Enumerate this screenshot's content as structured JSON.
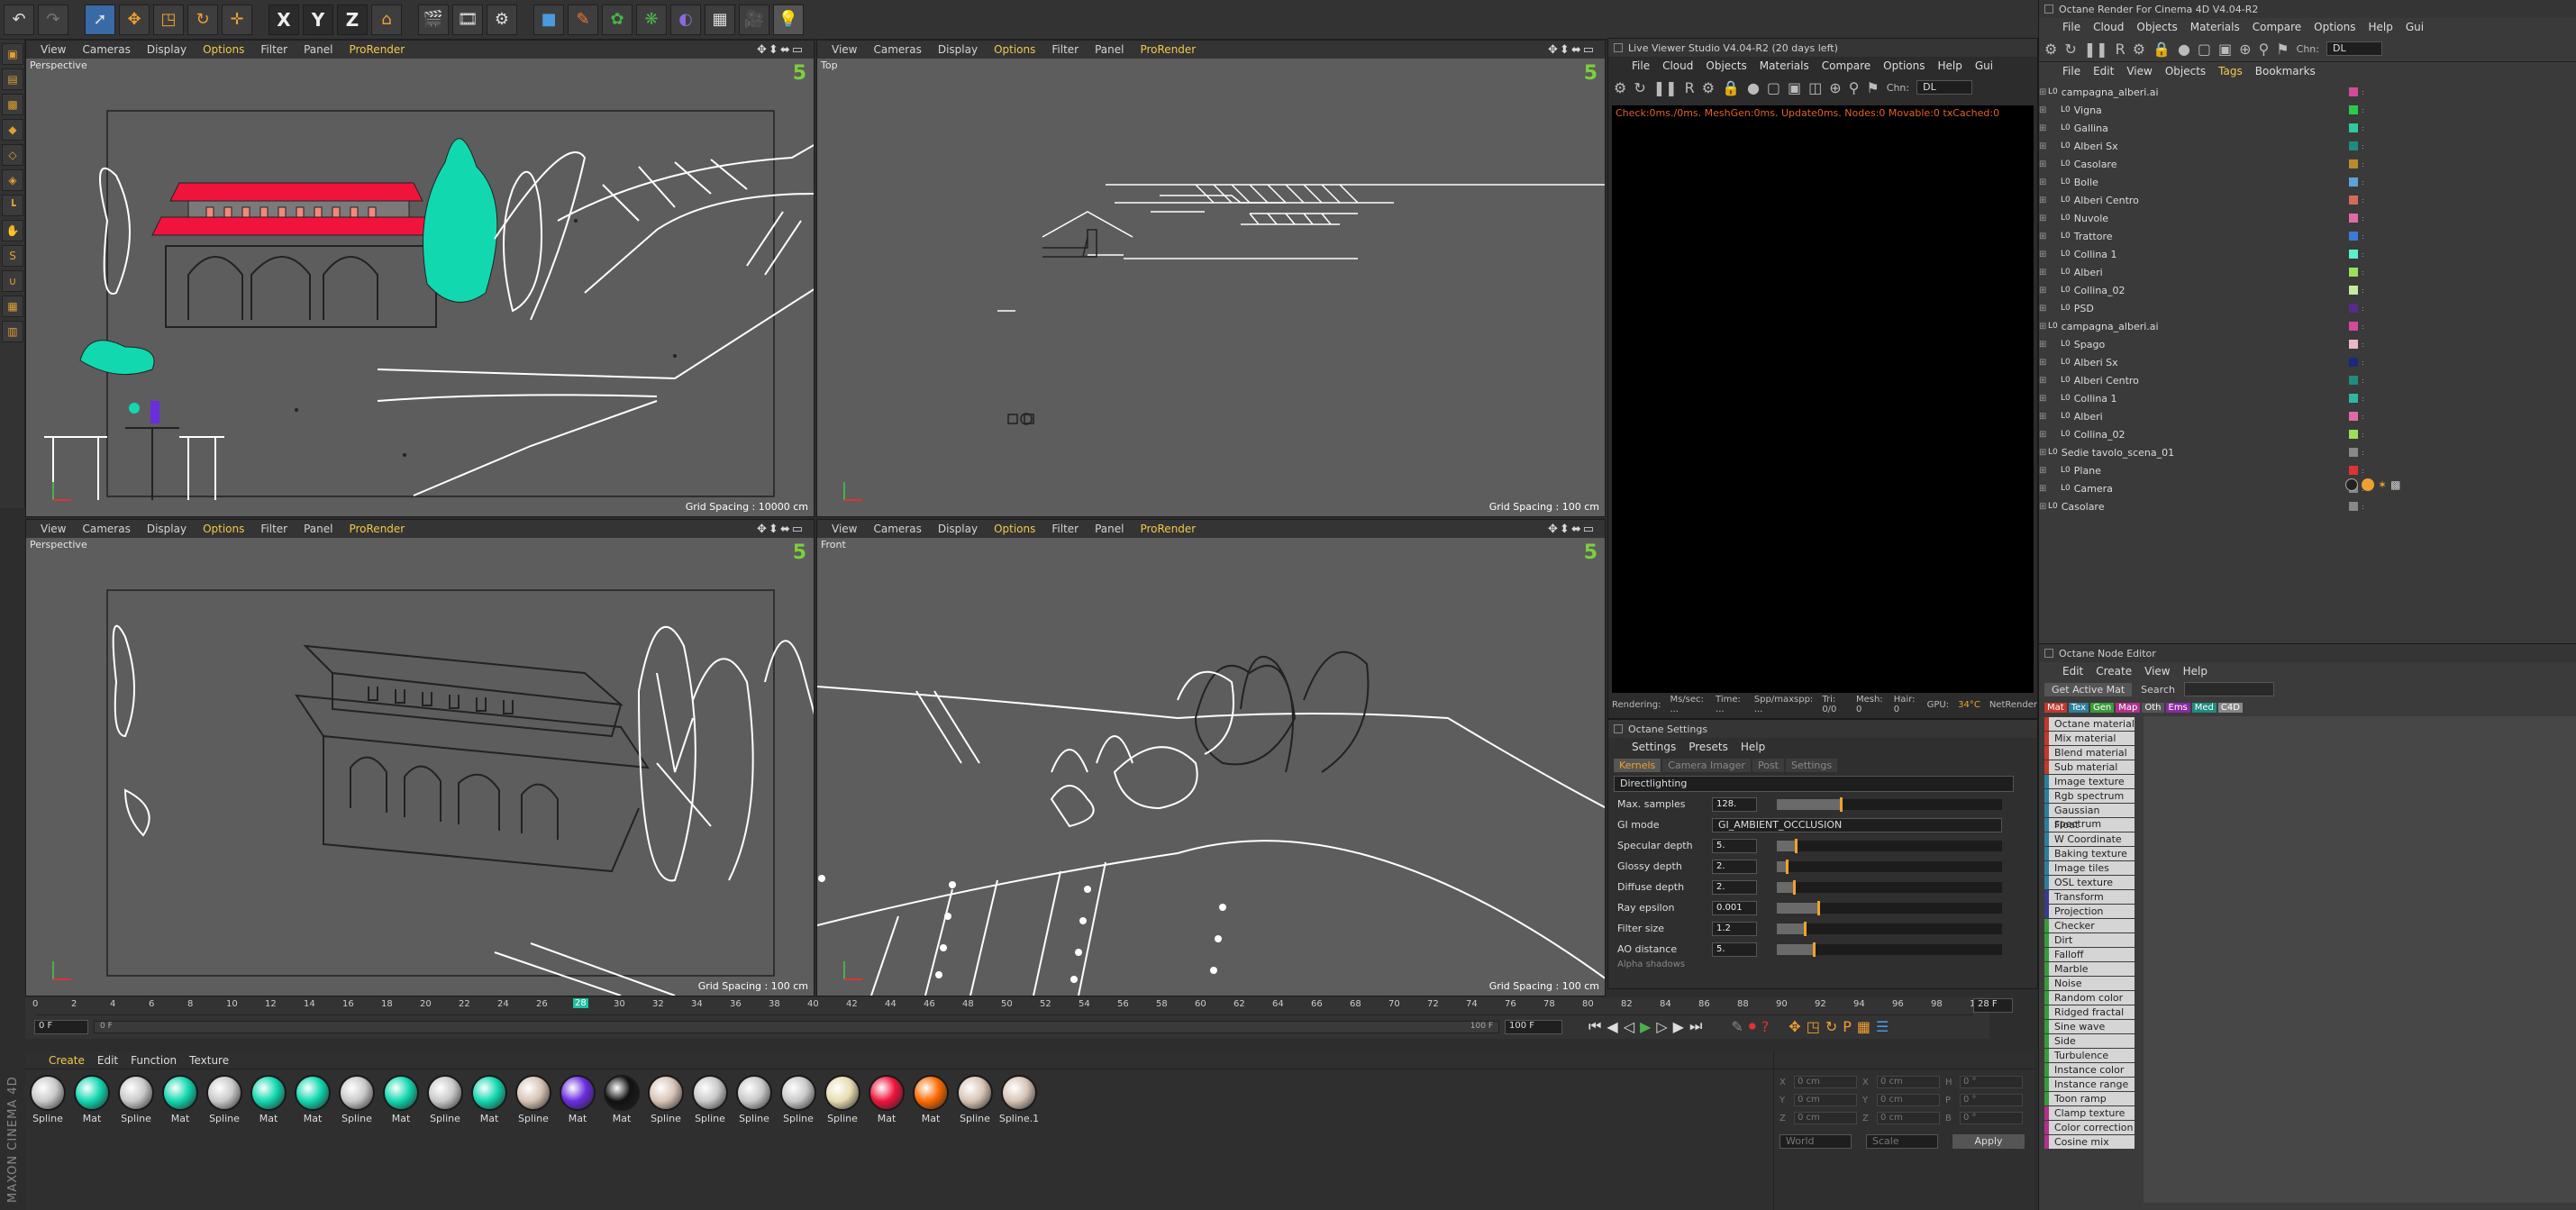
{
  "main_toolbar": {
    "axis_x": "X",
    "axis_y": "Y",
    "axis_z": "Z"
  },
  "viewports": {
    "menu": [
      "View",
      "Cameras",
      "Display",
      "Options",
      "Filter",
      "Panel",
      "ProRender"
    ],
    "vp1": {
      "name": "Perspective",
      "grid_spacing": "Grid Spacing : 10000 cm"
    },
    "vp2": {
      "name": "Top",
      "grid_spacing": "Grid Spacing : 100 cm"
    },
    "vp3": {
      "name": "Perspective",
      "grid_spacing": "Grid Spacing : 100 cm"
    },
    "vp4": {
      "name": "Front",
      "grid_spacing": "Grid Spacing : 100 cm"
    },
    "number_badge": "5"
  },
  "live_viewer": {
    "title": "Live Viewer Studio V4.04-R2 (20 days left)",
    "menu": [
      "File",
      "Cloud",
      "Objects",
      "Materials",
      "Compare",
      "Options",
      "Help",
      "Gui"
    ],
    "channel_label": "Chn:",
    "channel_value": "DL",
    "status_line": "Check:0ms./0ms. MeshGen:0ms. Update0ms. Nodes:0 Movable:0 txCached:0",
    "footer_items": [
      "Rendering:",
      "Ms/sec: ...",
      "Time: ...",
      "Spp/maxspp: ...",
      "Tri: 0/0",
      "Mesh: 0",
      "Hair: 0",
      "GPU:",
      "34°C",
      "NetRender"
    ]
  },
  "octane_settings": {
    "title": "Octane Settings",
    "menu": [
      "Settings",
      "Presets",
      "Help"
    ],
    "tabs": [
      "Kernels",
      "Camera Imager",
      "Post",
      "Settings"
    ],
    "kernel_dropdown": "Directlighting",
    "rows": [
      {
        "label": "Max. samples",
        "value": "128.",
        "fill": 0.28
      },
      {
        "label": "GI mode",
        "value": "GI_AMBIENT_OCCLUSION"
      },
      {
        "label": "Specular depth",
        "value": "5.",
        "fill": 0.08
      },
      {
        "label": "Glossy depth",
        "value": "2.",
        "fill": 0.04
      },
      {
        "label": "Diffuse depth",
        "value": "2.",
        "fill": 0.07
      },
      {
        "label": "Ray epsilon",
        "value": "0.001",
        "fill": 0.18
      },
      {
        "label": "Filter size",
        "value": "1.2",
        "fill": 0.12
      },
      {
        "label": "AO distance",
        "value": "5.",
        "fill": 0.16
      }
    ],
    "footer": "Alpha shadows"
  },
  "timeline": {
    "ticks": [
      "0",
      "2",
      "4",
      "6",
      "8",
      "10",
      "12",
      "14",
      "16",
      "18",
      "20",
      "22",
      "24",
      "26",
      "28",
      "30",
      "32",
      "34",
      "36",
      "38",
      "40",
      "42",
      "44",
      "46",
      "48",
      "50",
      "52",
      "54",
      "56",
      "58",
      "60",
      "62",
      "64",
      "66",
      "68",
      "70",
      "72",
      "74",
      "76",
      "78",
      "80",
      "82",
      "84",
      "86",
      "88",
      "90",
      "92",
      "94",
      "96",
      "98",
      "100"
    ],
    "current_frame": "28",
    "end_field": "28 F",
    "start_field": "0 F",
    "range_start": "0 F",
    "range_end": "100 F",
    "range_end2": "100 F"
  },
  "material_manager": {
    "menu": [
      "Create",
      "Edit",
      "Function",
      "Texture"
    ],
    "items": [
      {
        "label": "Spline",
        "color": "#c9c9c9"
      },
      {
        "label": "Mat",
        "color": "#12d8b0"
      },
      {
        "label": "Spline",
        "color": "#c9c9c9"
      },
      {
        "label": "Mat",
        "color": "#12d8b0"
      },
      {
        "label": "Spline",
        "color": "#c9c9c9"
      },
      {
        "label": "Mat",
        "color": "#12d8b0"
      },
      {
        "label": "Mat",
        "color": "#12d8b0"
      },
      {
        "label": "Spline",
        "color": "#c9c9c9"
      },
      {
        "label": "Mat",
        "color": "#12d8b0"
      },
      {
        "label": "Spline",
        "color": "#c9c9c9"
      },
      {
        "label": "Mat",
        "color": "#12d8b0"
      },
      {
        "label": "Spline",
        "color": "#d8c4b5"
      },
      {
        "label": "Mat",
        "color": "#6a2ce0"
      },
      {
        "label": "Mat",
        "color": "#111111"
      },
      {
        "label": "Spline",
        "color": "#d8c4b5"
      },
      {
        "label": "Spline",
        "color": "#c9c9c9"
      },
      {
        "label": "Spline",
        "color": "#c9c9c9"
      },
      {
        "label": "Spline",
        "color": "#c9c9c9"
      },
      {
        "label": "Spline",
        "color": "#e8dcb0"
      },
      {
        "label": "Mat",
        "color": "#f0143c"
      },
      {
        "label": "Mat",
        "color": "#ff6a00"
      },
      {
        "label": "Spline",
        "color": "#d8c4b5"
      },
      {
        "label": "Spline.1",
        "color": "#d8c4b5"
      }
    ]
  },
  "coordinates": {
    "rows": [
      {
        "a": "X",
        "av": "0 cm",
        "b": "X",
        "bv": "0 cm",
        "c": "H",
        "cv": "0 °"
      },
      {
        "a": "Y",
        "av": "0 cm",
        "b": "Y",
        "bv": "0 cm",
        "c": "P",
        "cv": "0 °"
      },
      {
        "a": "Z",
        "av": "0 cm",
        "b": "Z",
        "bv": "0 cm",
        "c": "B",
        "cv": "0 °"
      }
    ],
    "world": "World",
    "scale": "Scale",
    "apply": "Apply"
  },
  "right_panel": {
    "title": "Octane Render For Cinema 4D V4.04-R2",
    "menu": [
      "File",
      "Cloud",
      "Objects",
      "Materials",
      "Compare",
      "Options",
      "Help",
      "Gui"
    ],
    "channel_label": "Chn:",
    "channel_value": "DL",
    "obj_menu": [
      "File",
      "Edit",
      "View",
      "Objects",
      "Tags",
      "Bookmarks"
    ],
    "objects": [
      {
        "name": "campagna_alberi.ai",
        "indent": 0,
        "color": "#d34a9a"
      },
      {
        "name": "Vigna",
        "indent": 1,
        "color": "#2fc94a"
      },
      {
        "name": "Gallina",
        "indent": 1,
        "color": "#2fc9a0"
      },
      {
        "name": "Alberi Sx",
        "indent": 1,
        "color": "#1e8c80"
      },
      {
        "name": "Casolare",
        "indent": 1,
        "color": "#b98a2b"
      },
      {
        "name": "Bolle",
        "indent": 1,
        "color": "#5fa0d8"
      },
      {
        "name": "Alberi Centro",
        "indent": 1,
        "color": "#d56a5a"
      },
      {
        "name": "Nuvole",
        "indent": 1,
        "color": "#e06aa8"
      },
      {
        "name": "Trattore",
        "indent": 1,
        "color": "#3a7ad8"
      },
      {
        "name": "Collina 1",
        "indent": 1,
        "color": "#5cf0c8"
      },
      {
        "name": "Alberi",
        "indent": 1,
        "color": "#9ae05a"
      },
      {
        "name": "Collina_02",
        "indent": 1,
        "color": "#c6e8a0"
      },
      {
        "name": "PSD",
        "indent": 1,
        "color": "#5a2a8a"
      },
      {
        "name": "campagna_alberi.ai",
        "indent": 0,
        "color": "#d34a9a"
      },
      {
        "name": "Spago",
        "indent": 1,
        "color": "#e8b8c8"
      },
      {
        "name": "Alberi Sx",
        "indent": 1,
        "color": "#1a2a7a"
      },
      {
        "name": "Alberi Centro",
        "indent": 1,
        "color": "#1e8c80"
      },
      {
        "name": "Collina 1",
        "indent": 1,
        "color": "#2fb8a0"
      },
      {
        "name": "Alberi",
        "indent": 1,
        "color": "#e06aa8"
      },
      {
        "name": "Collina_02",
        "indent": 1,
        "color": "#9ae05a"
      },
      {
        "name": "Sedie tavolo_scena_01",
        "indent": 0,
        "color": "#888888"
      },
      {
        "name": "Plane",
        "indent": 1,
        "color": "#d33"
      },
      {
        "name": "Camera",
        "indent": 1,
        "color": "#888888"
      },
      {
        "name": "Casolare",
        "indent": 0,
        "color": "#888888"
      }
    ],
    "node_editor": {
      "title": "Octane Node Editor",
      "menu": [
        "Edit",
        "Create",
        "View",
        "Help"
      ],
      "get_active": "Get Active Mat",
      "search_label": "Search",
      "filter_tabs": [
        {
          "label": "Mat",
          "color": "#c0392b"
        },
        {
          "label": "Tex",
          "color": "#2e7d9a"
        },
        {
          "label": "Gen",
          "color": "#3a9a3a"
        },
        {
          "label": "Map",
          "color": "#b0308a"
        },
        {
          "label": "Oth",
          "color": "#555555"
        },
        {
          "label": "Ems",
          "color": "#8a2aa0"
        },
        {
          "label": "Med",
          "color": "#1e8c80"
        },
        {
          "label": "C4D",
          "color": "#888888"
        }
      ],
      "nodes": [
        {
          "label": "Octane material",
          "border": "#c0392b"
        },
        {
          "label": "Mix material",
          "border": "#c0392b"
        },
        {
          "label": "Blend material",
          "border": "#c0392b"
        },
        {
          "label": "Sub material",
          "border": "#c0392b"
        },
        {
          "label": "Image texture",
          "border": "#2e7d9a"
        },
        {
          "label": "Rgb spectrum",
          "border": "#2e7d9a"
        },
        {
          "label": "Gaussian spectrum",
          "border": "#2e7d9a"
        },
        {
          "label": "Float",
          "border": "#2e7d9a"
        },
        {
          "label": "W Coordinate",
          "border": "#2e7d9a"
        },
        {
          "label": "Baking texture",
          "border": "#2e7d9a"
        },
        {
          "label": "Image tiles",
          "border": "#2e7d9a"
        },
        {
          "label": "OSL texture",
          "border": "#2e7d9a"
        },
        {
          "label": "Transform",
          "border": "#3a3a8a"
        },
        {
          "label": "Projection",
          "border": "#3a3a8a"
        },
        {
          "label": "Checker",
          "border": "#3a9a3a"
        },
        {
          "label": "Dirt",
          "border": "#3a9a3a"
        },
        {
          "label": "Falloff",
          "border": "#3a9a3a"
        },
        {
          "label": "Marble",
          "border": "#3a9a3a"
        },
        {
          "label": "Noise",
          "border": "#3a9a3a"
        },
        {
          "label": "Random color",
          "border": "#3a9a3a"
        },
        {
          "label": "Ridged fractal",
          "border": "#3a9a3a"
        },
        {
          "label": "Sine wave",
          "border": "#3a9a3a"
        },
        {
          "label": "Side",
          "border": "#3a9a3a"
        },
        {
          "label": "Turbulence",
          "border": "#3a9a3a"
        },
        {
          "label": "Instance color",
          "border": "#3a9a3a"
        },
        {
          "label": "Instance range",
          "border": "#3a9a3a"
        },
        {
          "label": "Toon ramp",
          "border": "#3a9a3a"
        },
        {
          "label": "Clamp texture",
          "border": "#b0308a"
        },
        {
          "label": "Color correction",
          "border": "#b0308a"
        },
        {
          "label": "Cosine mix",
          "border": "#b0308a"
        }
      ]
    }
  },
  "bottom_brand": "MAXON CINEMA 4D"
}
